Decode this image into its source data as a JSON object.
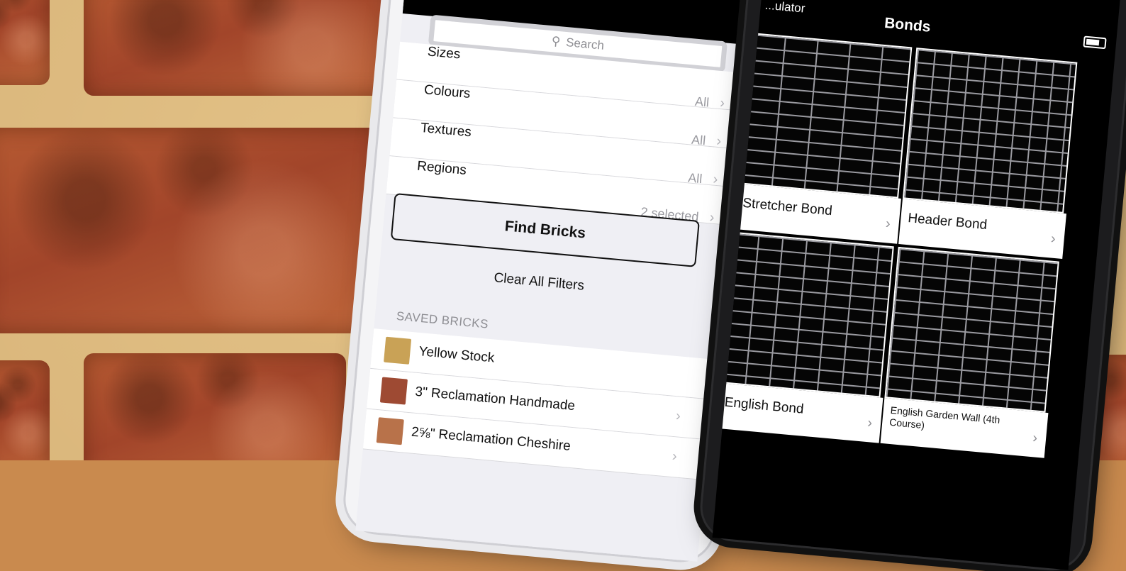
{
  "phone1": {
    "search": {
      "icon": "search-icon",
      "placeholder": "Search"
    },
    "filters": [
      {
        "label": "Sizes",
        "value": "All"
      },
      {
        "label": "Colours",
        "value": "All"
      },
      {
        "label": "Textures",
        "value": "All"
      },
      {
        "label": "Regions",
        "value": "2 selected"
      }
    ],
    "find_bricks_label": "Find Bricks",
    "clear_filters_label": "Clear All Filters",
    "saved_header": "SAVED BRICKS",
    "saved_bricks": [
      {
        "name": "Yellow Stock",
        "color": "#c9a256"
      },
      {
        "name": "3\" Reclamation Handmade",
        "color": "#9e4a33"
      },
      {
        "name": "2⅝\" Reclamation Cheshire",
        "color": "#b8724a"
      }
    ]
  },
  "phone2": {
    "status_left": "...ulator",
    "title": "Bonds",
    "bonds": [
      {
        "label": "Stretcher Bond"
      },
      {
        "label": "Header Bond"
      },
      {
        "label": "English Bond"
      },
      {
        "label": "English Garden Wall (4th Course)"
      }
    ]
  },
  "colors": {
    "brick": "#a2452a",
    "mortar": "#d9b57a",
    "nav_bg": "#000000"
  }
}
